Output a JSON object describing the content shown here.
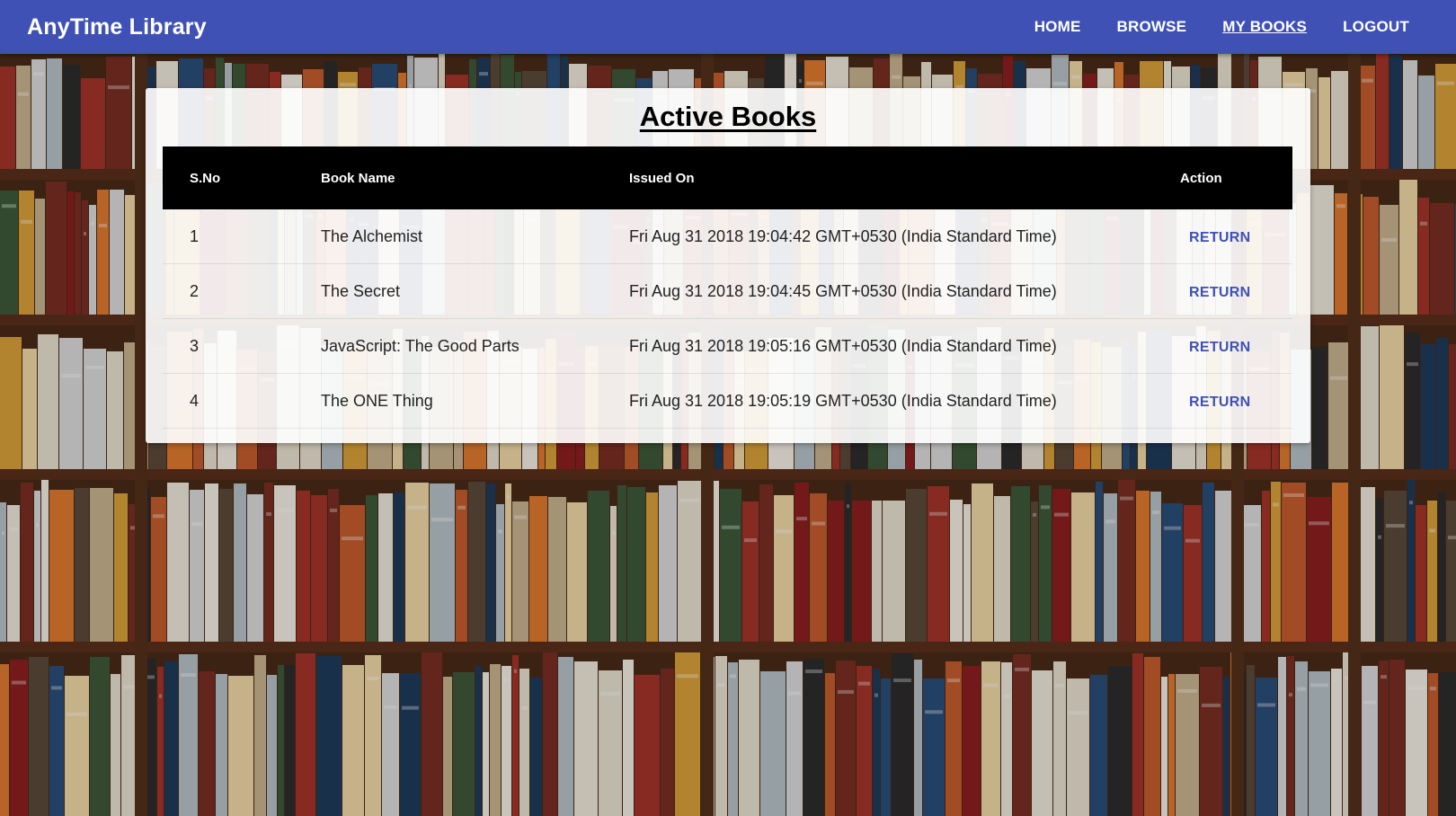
{
  "navbar": {
    "brand": "AnyTime Library",
    "links": [
      {
        "label": "HOME",
        "active": false
      },
      {
        "label": "BROWSE",
        "active": false
      },
      {
        "label": "MY BOOKS",
        "active": true
      },
      {
        "label": "LOGOUT",
        "active": false
      }
    ]
  },
  "colors": {
    "navbar": "#3f51b5",
    "accent": "#3f51b5",
    "table_header": "#000000"
  },
  "main": {
    "title": "Active Books",
    "table": {
      "headers": [
        "S.No",
        "Book Name",
        "Issued On",
        "Action"
      ],
      "rows": [
        {
          "sno": "1",
          "name": "The Alchemist",
          "issued": "Fri Aug 31 2018 19:04:42 GMT+0530 (India Standard Time)",
          "action": "RETURN"
        },
        {
          "sno": "2",
          "name": "The Secret",
          "issued": "Fri Aug 31 2018 19:04:45 GMT+0530 (India Standard Time)",
          "action": "RETURN"
        },
        {
          "sno": "3",
          "name": "JavaScript: The Good Parts",
          "issued": "Fri Aug 31 2018 19:05:16 GMT+0530 (India Standard Time)",
          "action": "RETURN"
        },
        {
          "sno": "4",
          "name": "The ONE Thing",
          "issued": "Fri Aug 31 2018 19:05:19 GMT+0530 (India Standard Time)",
          "action": "RETURN"
        }
      ]
    }
  },
  "background": {
    "image": "bookshelf-photo"
  }
}
